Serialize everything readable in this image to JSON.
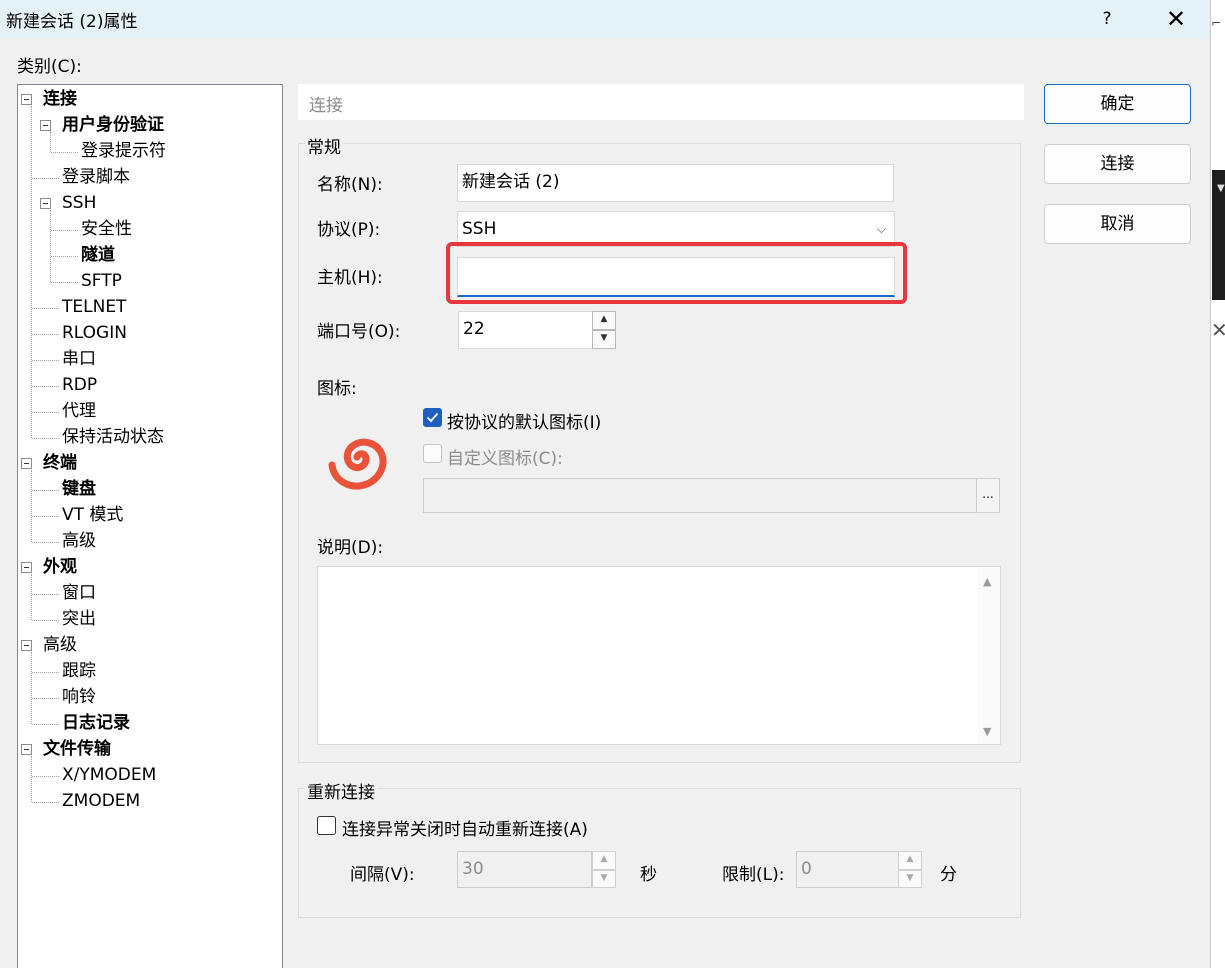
{
  "window": {
    "title": "新建会话 (2)属性",
    "help": "?",
    "close": "✕"
  },
  "category_label": "类别(C):",
  "tree": [
    {
      "label": "连接",
      "level": 0,
      "bold": true,
      "expander": true
    },
    {
      "label": "用户身份验证",
      "level": 1,
      "bold": true,
      "expander": true
    },
    {
      "label": "登录提示符",
      "level": 2,
      "bold": false,
      "expander": false
    },
    {
      "label": "登录脚本",
      "level": 1,
      "bold": false,
      "expander": false
    },
    {
      "label": "SSH",
      "level": 1,
      "bold": false,
      "expander": true
    },
    {
      "label": "安全性",
      "level": 2,
      "bold": false,
      "expander": false
    },
    {
      "label": "隧道",
      "level": 2,
      "bold": true,
      "expander": false
    },
    {
      "label": "SFTP",
      "level": 2,
      "bold": false,
      "expander": false
    },
    {
      "label": "TELNET",
      "level": 1,
      "bold": false,
      "expander": false
    },
    {
      "label": "RLOGIN",
      "level": 1,
      "bold": false,
      "expander": false
    },
    {
      "label": "串口",
      "level": 1,
      "bold": false,
      "expander": false
    },
    {
      "label": "RDP",
      "level": 1,
      "bold": false,
      "expander": false
    },
    {
      "label": "代理",
      "level": 1,
      "bold": false,
      "expander": false
    },
    {
      "label": "保持活动状态",
      "level": 1,
      "bold": false,
      "expander": false
    },
    {
      "label": "终端",
      "level": 0,
      "bold": true,
      "expander": true
    },
    {
      "label": "键盘",
      "level": 1,
      "bold": true,
      "expander": false
    },
    {
      "label": "VT 模式",
      "level": 1,
      "bold": false,
      "expander": false
    },
    {
      "label": "高级",
      "level": 1,
      "bold": false,
      "expander": false
    },
    {
      "label": "外观",
      "level": 0,
      "bold": true,
      "expander": true
    },
    {
      "label": "窗口",
      "level": 1,
      "bold": false,
      "expander": false
    },
    {
      "label": "突出",
      "level": 1,
      "bold": false,
      "expander": false
    },
    {
      "label": "高级",
      "level": 0,
      "bold": false,
      "expander": true
    },
    {
      "label": "跟踪",
      "level": 1,
      "bold": false,
      "expander": false
    },
    {
      "label": "响铃",
      "level": 1,
      "bold": false,
      "expander": false
    },
    {
      "label": "日志记录",
      "level": 1,
      "bold": true,
      "expander": false
    },
    {
      "label": "文件传输",
      "level": 0,
      "bold": true,
      "expander": true
    },
    {
      "label": "X/YMODEM",
      "level": 1,
      "bold": false,
      "expander": false
    },
    {
      "label": "ZMODEM",
      "level": 1,
      "bold": false,
      "expander": false
    }
  ],
  "section": {
    "title": "连接"
  },
  "general": {
    "legend": "常规",
    "name_label": "名称(N):",
    "name_value": "新建会话 (2)",
    "protocol_label": "协议(P):",
    "protocol_value": "SSH",
    "host_label": "主机(H):",
    "host_value": "",
    "port_label": "端口号(O):",
    "port_value": "22",
    "icon_label": "图标:",
    "default_icon_label": "按协议的默认图标(I)",
    "default_icon_checked": true,
    "custom_icon_label": "自定义图标(C):",
    "custom_icon_checked": false,
    "custom_icon_path": "",
    "browse": "...",
    "description_label": "说明(D):",
    "description_value": ""
  },
  "reconnect": {
    "legend": "重新连接",
    "auto_label": "连接异常关闭时自动重新连接(A)",
    "auto_checked": false,
    "interval_label": "间隔(V):",
    "interval_value": "30",
    "interval_unit": "秒",
    "limit_label": "限制(L):",
    "limit_value": "0",
    "limit_unit": "分"
  },
  "buttons": {
    "ok": "确定",
    "connect": "连接",
    "cancel": "取消"
  },
  "colors": {
    "highlight": "#e8373d",
    "accent": "#1f5fbf",
    "logo": "#e8533a"
  }
}
